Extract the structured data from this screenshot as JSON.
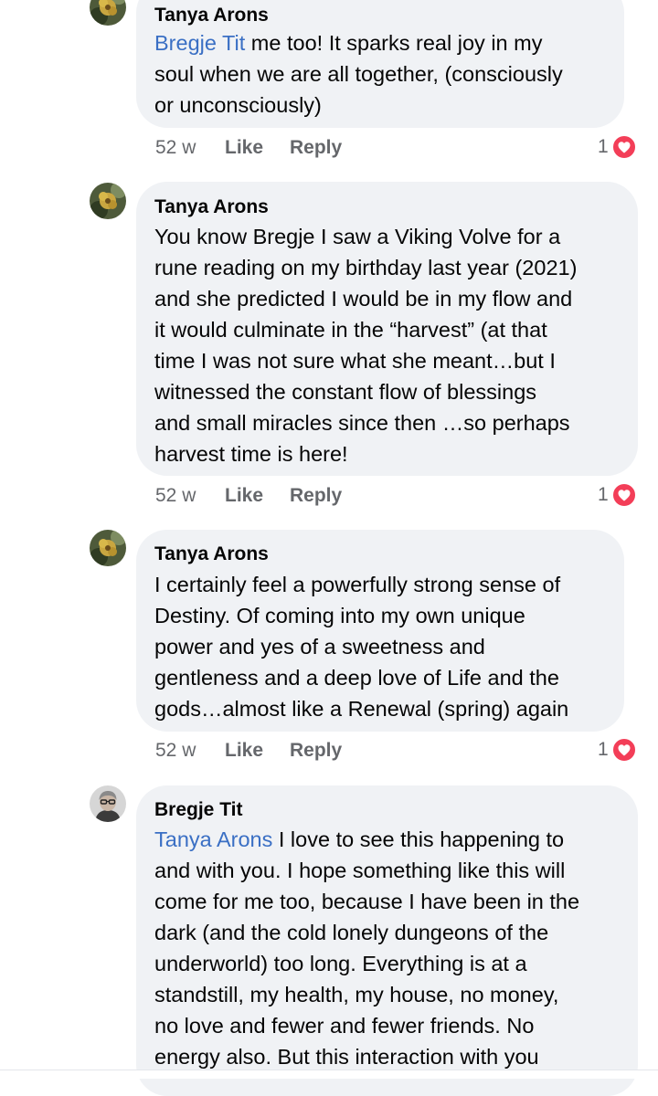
{
  "comments": [
    {
      "author": "Tanya Arons",
      "mention": "Bregje Tit",
      "lines": [
        " me too! It sparks real joy in my",
        "soul when we are all together, (consciously",
        "or unconsciously)"
      ],
      "time": "52 w",
      "like_label": "Like",
      "reply_label": "Reply",
      "reaction_count": "1",
      "reaction_icon": "love-reaction-icon"
    },
    {
      "author": "Tanya Arons",
      "mention": "",
      "lines": [
        "You know Bregje I saw a Viking Volve for a",
        "rune reading on my birthday last year (2021)",
        "and she predicted I would be in my flow and",
        "it would culminate in the “harvest” (at that",
        "time I was not sure what she meant…but I",
        "witnessed the constant flow of blessings",
        "and small miracles since then …so perhaps",
        "harvest time is here!"
      ],
      "time": "52 w",
      "like_label": "Like",
      "reply_label": "Reply",
      "reaction_count": "1",
      "reaction_icon": "love-reaction-icon"
    },
    {
      "author": "Tanya Arons",
      "mention": "",
      "lines": [
        "I certainly feel a powerfully strong sense of",
        "Destiny.  Of coming into my own unique",
        "power and yes of a sweetness and",
        "gentleness and a deep love of Life and the",
        "gods…almost like a Renewal (spring) again"
      ],
      "time": "52 w",
      "like_label": "Like",
      "reply_label": "Reply",
      "reaction_count": "1",
      "reaction_icon": "love-reaction-icon"
    },
    {
      "author": "Bregje Tit",
      "mention": "Tanya Arons",
      "lines": [
        " I love to see this happening to",
        "and with you. I hope something like this will",
        "come for me too, because I have been in the",
        "dark (and the cold lonely dungeons of the",
        "underworld) too long. Everything is at a",
        "standstill, my health, my house, no money,",
        "no love and fewer and fewer friends. No",
        "energy also. But this interaction with you"
      ]
    }
  ],
  "colors": {
    "bubble": "#f0f2f5",
    "mention": "#3a6fc4",
    "meta": "#65676b",
    "love": "#f33e58"
  }
}
